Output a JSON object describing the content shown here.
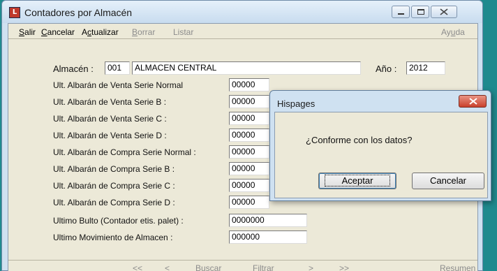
{
  "window": {
    "title": "Contadores por Almacén",
    "icon_letter": "L"
  },
  "menu": {
    "salir_first": "S",
    "salir_rest": "alir",
    "cancelar_first": "C",
    "cancelar_rest": "ancelar",
    "actualizar_a": "A",
    "actualizar_c": "c",
    "actualizar_rest": "tualizar",
    "borrar_first": "B",
    "borrar_rest": "orrar",
    "listar": "Listar",
    "ayuda_pre": "Ay",
    "ayuda_u": "u",
    "ayuda_rest": "da"
  },
  "form": {
    "almacen_label": "Almacén :",
    "almacen_code": "001",
    "almacen_name": "ALMACEN CENTRAL",
    "anio_label": "Año :",
    "anio_value": "2012",
    "rows": [
      {
        "label": "Ult. Albarán de Venta Serie Normal",
        "value": "00000"
      },
      {
        "label": "Ult. Albarán de Venta Serie B :",
        "value": "00000"
      },
      {
        "label": "Ult. Albarán de Venta Serie C :",
        "value": "00000"
      },
      {
        "label": "Ult. Albarán de Venta Serie D :",
        "value": "00000"
      },
      {
        "label": "Ult. Albarán de Compra Serie Normal :",
        "value": "00000"
      },
      {
        "label": "Ult. Albarán de Compra Serie B :",
        "value": "00000"
      },
      {
        "label": "Ult. Albarán de Compra Serie C :",
        "value": "00000"
      },
      {
        "label": "Ult. Albarán de Compra Serie D :",
        "value": "00000"
      },
      {
        "label": "Ultimo Bulto (Contador etis. palet) :",
        "value": "0000000"
      },
      {
        "label": "Ultimo Movimiento de Almacen :",
        "value": "000000"
      }
    ]
  },
  "nav": {
    "first": "<<",
    "prev": "<",
    "buscar": "Buscar",
    "filtrar": "Filtrar",
    "next": ">",
    "last": ">>",
    "resumen": "Resumen"
  },
  "dialog": {
    "title": "Hispages",
    "message": "¿Conforme con los datos?",
    "ok_label": "Aceptar",
    "cancel_label": "Cancelar"
  },
  "colors": {
    "desktop": "#1f8a8e",
    "window_frame": "#cfe1f1",
    "client": "#ece9d8",
    "close_red": "#c9412d"
  }
}
